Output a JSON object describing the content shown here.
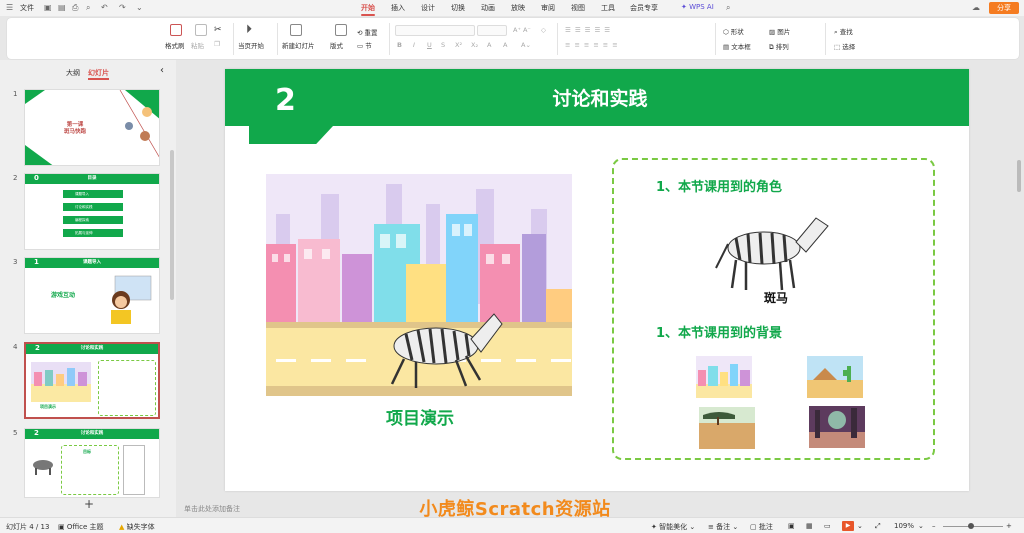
{
  "titlebar": {
    "file_menu": "文件",
    "tabs": [
      "开始",
      "插入",
      "设计",
      "切换",
      "动画",
      "放映",
      "审阅",
      "视图",
      "工具",
      "会员专享"
    ],
    "active_tab": "开始",
    "wps_ai": "WPS AI",
    "share": "分享"
  },
  "ribbon": {
    "format_painter": "格式刷",
    "paste": "粘贴",
    "from_current": "当页开始",
    "new_slide": "新建幻灯片",
    "layout": "版式",
    "reset": "重置",
    "section": "节",
    "shape": "形状",
    "picture": "图片",
    "textbox": "文本框",
    "arrange": "排列",
    "find": "查找",
    "select": "选择"
  },
  "leftpane": {
    "outline_tab": "大纲",
    "slides_tab": "幻灯片",
    "collapse": "‹",
    "add": "+",
    "slides": [
      {
        "num": "1",
        "title_line1": "第一课",
        "title_line2": "斑马快跑"
      },
      {
        "num": "2",
        "header_num": "0",
        "header_title": "目录",
        "items": [
          "课题导入",
          "讨论和实践",
          "编程探索",
          "拓展与延伸"
        ]
      },
      {
        "num": "3",
        "header_num": "1",
        "header_title": "课题导入",
        "body": "游戏互动"
      },
      {
        "num": "4",
        "header_num": "2",
        "header_title": "讨论和实践",
        "body": "项目演示"
      },
      {
        "num": "5",
        "header_num": "2",
        "header_title": "讨论和实践",
        "body": "目标"
      }
    ]
  },
  "slide": {
    "number": "2",
    "title": "讨论和实践",
    "demo_label": "项目演示",
    "roles_heading": "1、本节课用到的角色",
    "zebra_label": "斑马",
    "bg_heading": "1、本节课用到的背景"
  },
  "notes": {
    "placeholder": "单击此处添加备注"
  },
  "watermark": "小虎鲸Scratch资源站",
  "status": {
    "slide_count": "幻灯片 4 / 13",
    "theme": "Office 主题",
    "missing_font": "缺失字体",
    "smart_beautify": "智能美化",
    "notes": "备注",
    "comments": "批注",
    "zoom": "109%"
  },
  "colors": {
    "accent_green": "#11a84b",
    "dash_green": "#7ac943",
    "brand_orange": "#f57c21",
    "active_red": "#d9534f"
  }
}
